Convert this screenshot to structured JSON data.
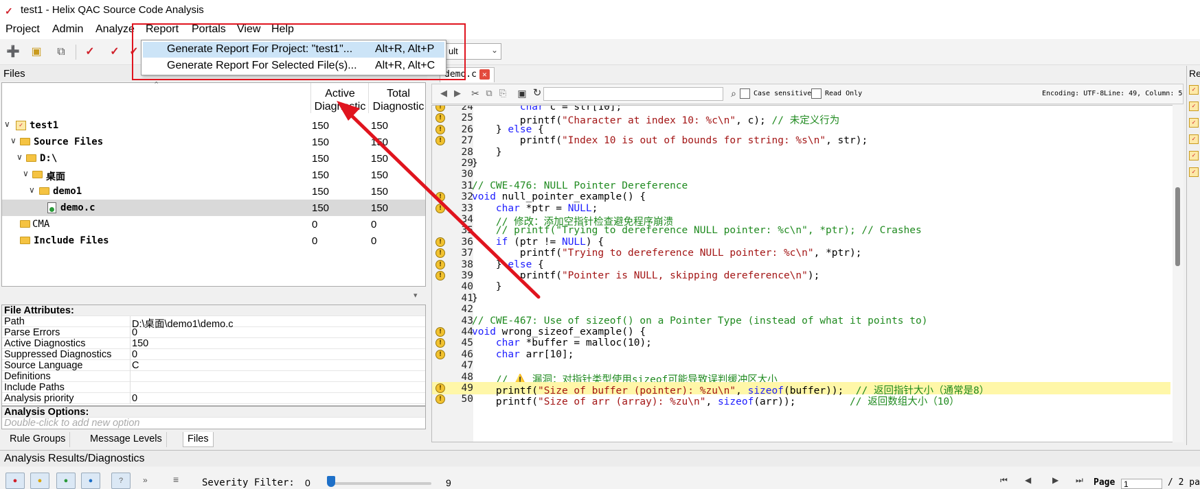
{
  "window": {
    "title": "test1 - Helix QAC Source Code Analysis"
  },
  "menubar": [
    "Project",
    "Admin",
    "Analyze",
    "Report",
    "Portals",
    "View",
    "Help"
  ],
  "toolbar": {
    "config_combo": "ult"
  },
  "report_menu": {
    "items": [
      {
        "label": "Generate Report For Project: \"test1\"...",
        "shortcut": "Alt+R, Alt+P",
        "highlighted": true
      },
      {
        "label": "Generate Report For Selected File(s)...",
        "shortcut": "Alt+R, Alt+C",
        "highlighted": false
      }
    ]
  },
  "files_panel": {
    "title": "Files",
    "columns": {
      "active": "Active\nDiagnostic",
      "total": "Total\nDiagnostic"
    },
    "rows": [
      {
        "name": "test1",
        "active": "150",
        "total": "150"
      },
      {
        "name": "Source Files",
        "active": "150",
        "total": "150"
      },
      {
        "name": "D:\\",
        "active": "150",
        "total": "150"
      },
      {
        "name": "桌面",
        "active": "150",
        "total": "150"
      },
      {
        "name": "demo1",
        "active": "150",
        "total": "150"
      },
      {
        "name": "demo.c",
        "active": "150",
        "total": "150"
      },
      {
        "name": "CMA",
        "active": "0",
        "total": "0"
      },
      {
        "name": "Include Files",
        "active": "0",
        "total": "0"
      }
    ]
  },
  "file_attributes": {
    "header": "File Attributes:",
    "rows": [
      {
        "key": "Path",
        "value": "D:\\桌面\\demo1\\demo.c"
      },
      {
        "key": "Parse Errors",
        "value": "0"
      },
      {
        "key": "Active Diagnostics",
        "value": "150"
      },
      {
        "key": "Suppressed Diagnostics",
        "value": "0"
      },
      {
        "key": "Source Language",
        "value": "C"
      },
      {
        "key": "Definitions",
        "value": ""
      },
      {
        "key": "Include Paths",
        "value": ""
      },
      {
        "key": "Analysis priority",
        "value": "0"
      }
    ],
    "options_header": "Analysis Options:",
    "options_hint": "Double-click to add new option"
  },
  "left_tabs": [
    "Rule Groups",
    "Message Levels",
    "Files"
  ],
  "editor": {
    "tab": "demo.c",
    "case_sensitive": "Case sensitive",
    "read_only": "Read Only",
    "encoding": "Encoding: UTF-8",
    "position": "Line: 49, Column: 5",
    "lines": [
      {
        "n": "24",
        "text": "        char c = str[10];",
        "mark": true
      },
      {
        "n": "25",
        "text": "        printf(\"Character at index 10: %c\\n\", c); // 未定义行为",
        "mark": true
      },
      {
        "n": "26",
        "text": "    } else {",
        "mark": true
      },
      {
        "n": "27",
        "text": "        printf(\"Index 10 is out of bounds for string: %s\\n\", str);",
        "mark": true
      },
      {
        "n": "28",
        "text": "    }",
        "mark": false
      },
      {
        "n": "29",
        "text": "}",
        "mark": false
      },
      {
        "n": "30",
        "text": "",
        "mark": false
      },
      {
        "n": "31",
        "text": "// CWE-476: NULL Pointer Dereference",
        "mark": false
      },
      {
        "n": "32",
        "text": "void null_pointer_example() {",
        "mark": true
      },
      {
        "n": "33",
        "text": "    char *ptr = NULL;",
        "mark": true
      },
      {
        "n": "34",
        "text": "    // 修改：添加空指针检查避免程序崩溃",
        "mark": false
      },
      {
        "n": "35",
        "text": "    // printf(\"Trying to dereference NULL pointer: %c\\n\", *ptr); // Crashes",
        "mark": false
      },
      {
        "n": "36",
        "text": "    if (ptr != NULL) {",
        "mark": true
      },
      {
        "n": "37",
        "text": "        printf(\"Trying to dereference NULL pointer: %c\\n\", *ptr);",
        "mark": true
      },
      {
        "n": "38",
        "text": "    } else {",
        "mark": true
      },
      {
        "n": "39",
        "text": "        printf(\"Pointer is NULL, skipping dereference\\n\");",
        "mark": true
      },
      {
        "n": "40",
        "text": "    }",
        "mark": false
      },
      {
        "n": "41",
        "text": "}",
        "mark": false
      },
      {
        "n": "42",
        "text": "",
        "mark": false
      },
      {
        "n": "43",
        "text": "// CWE-467: Use of sizeof() on a Pointer Type (instead of what it points to)",
        "mark": false
      },
      {
        "n": "44",
        "text": "void wrong_sizeof_example() {",
        "mark": true
      },
      {
        "n": "45",
        "text": "    char *buffer = malloc(10);",
        "mark": true
      },
      {
        "n": "46",
        "text": "    char arr[10];",
        "mark": true
      },
      {
        "n": "47",
        "text": "",
        "mark": false
      },
      {
        "n": "48",
        "text": "    // ⚠️ 漏洞：对指针类型使用sizeof可能导致误判缓冲区大小",
        "mark": false
      },
      {
        "n": "49",
        "text": "    printf(\"Size of buffer (pointer): %zu\\n\", sizeof(buffer));  // 返回指针大小（通常是8）",
        "mark": true
      },
      {
        "n": "50",
        "text": "    printf(\"Size of arr (array): %zu\\n\", sizeof(arr));         // 返回数组大小（10）",
        "mark": true
      }
    ],
    "highlight_line": "49"
  },
  "right_panel": {
    "title": "Re"
  },
  "bottom": {
    "title": "Analysis Results/Diagnostics",
    "severity_label": "Severity Filter:",
    "severity_min": "0",
    "severity_max": "9",
    "severity_value": 0,
    "page_label": "Page",
    "page_value": "1",
    "page_total": "/ 2 pa"
  },
  "colors": {
    "accent_red": "#e0141e",
    "selection": "#cce4f7",
    "highlight_line": "#fff7a8"
  }
}
